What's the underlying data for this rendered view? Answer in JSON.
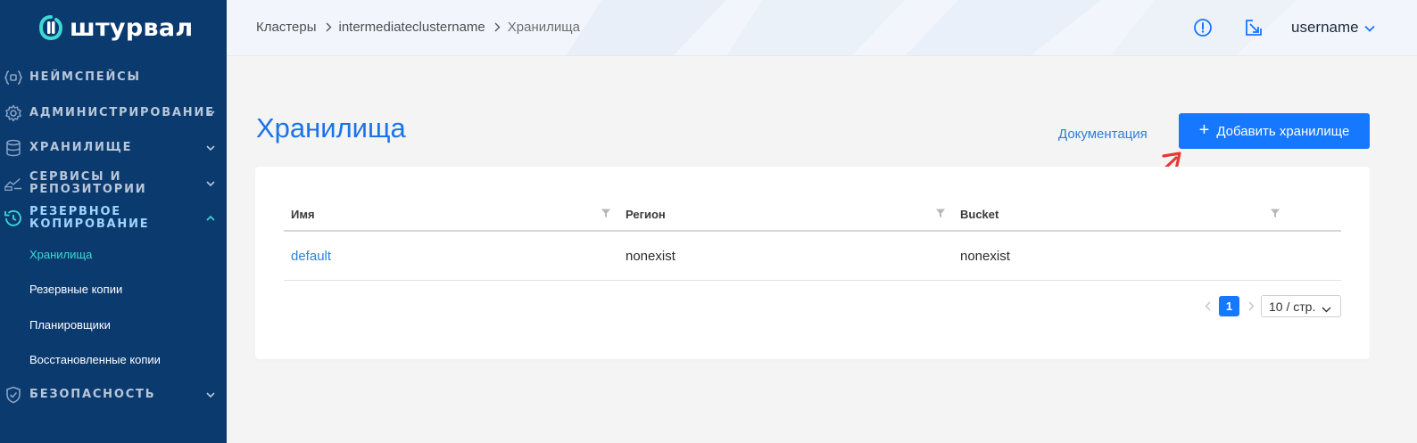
{
  "app": {
    "logo_text": "штурвал"
  },
  "sidebar": {
    "items": [
      {
        "label": "НЕЙМСПЕЙСЫ",
        "icon": "namespaces-icon",
        "has_chevron": false
      },
      {
        "label": "АДМИНИСТРИРОВАНИЕ",
        "icon": "gear-icon",
        "has_chevron": true,
        "chevron": "down"
      },
      {
        "label": "ХРАНИЛИЩЕ",
        "icon": "database-icon",
        "has_chevron": true,
        "chevron": "down"
      },
      {
        "label_line1": "СЕРВИСЫ И",
        "label_line2": "РЕПОЗИТОРИИ",
        "icon": "services-icon",
        "has_chevron": true,
        "chevron": "down"
      },
      {
        "label_line1": "РЕЗЕРВНОЕ",
        "label_line2": "КОПИРОВАНИЕ",
        "icon": "backup-history-icon",
        "has_chevron": true,
        "chevron": "up",
        "active": true
      },
      {
        "label": "БЕЗОПАСНОСТЬ",
        "icon": "shield-icon",
        "has_chevron": true,
        "chevron": "down"
      }
    ],
    "subitems": [
      {
        "label": "Хранилища",
        "active": true
      },
      {
        "label": "Резервные копии"
      },
      {
        "label": "Планировщики"
      },
      {
        "label": "Восстановленные копии"
      }
    ]
  },
  "header": {
    "breadcrumb": [
      "Кластеры",
      "intermediateclustername",
      "Хранилища"
    ],
    "user": "username"
  },
  "main": {
    "title": "Хранилища",
    "doc_link": "Документация",
    "add_button": "Добавить хранилище",
    "table": {
      "columns": [
        "Имя",
        "Регион",
        "Bucket"
      ],
      "rows": [
        {
          "name": "default",
          "region": "nonexist",
          "bucket": "nonexist"
        }
      ]
    },
    "pagination": {
      "current_page": "1",
      "page_size": "10 / стр."
    }
  },
  "colors": {
    "sidebar_bg": "#0b3a6f",
    "accent": "#1677ff",
    "title_blue": "#1a73e8",
    "active_sub": "#3dd9d6",
    "annotation_arrow": "#e53935"
  }
}
